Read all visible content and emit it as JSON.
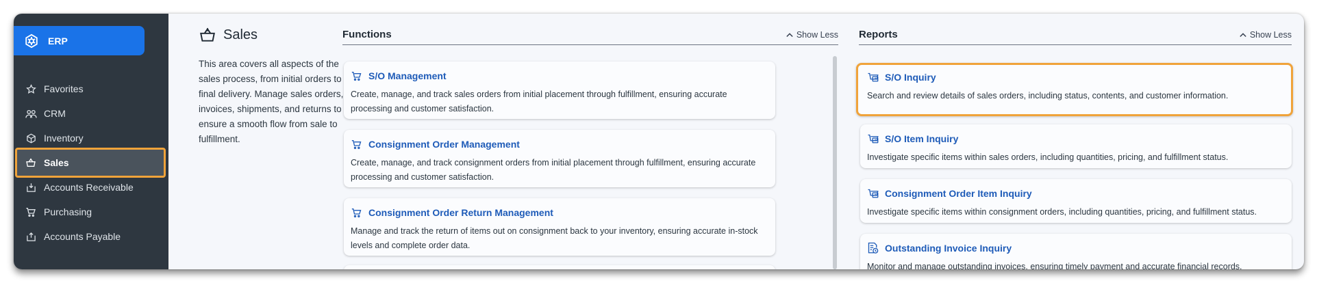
{
  "app": {
    "brand": "ERP"
  },
  "sidebar": {
    "items": [
      {
        "label": "Favorites",
        "icon": "star-icon"
      },
      {
        "label": "CRM",
        "icon": "people-icon"
      },
      {
        "label": "Inventory",
        "icon": "box-icon"
      },
      {
        "label": "Sales",
        "icon": "basket-icon",
        "active": true
      },
      {
        "label": "Accounts Receivable",
        "icon": "money-in-icon"
      },
      {
        "label": "Purchasing",
        "icon": "cart-icon"
      },
      {
        "label": "Accounts Payable",
        "icon": "money-out-icon"
      }
    ]
  },
  "section": {
    "title": "Sales",
    "description": "This area covers all aspects of the sales process, from initial orders to final delivery. Manage sales orders, invoices, shipments, and returns to ensure a smooth flow from sale to fulfillment."
  },
  "functions": {
    "title": "Functions",
    "toggle": "Show Less",
    "cards": [
      {
        "title": "S/O Management",
        "desc": "Create, manage, and track sales orders from initial placement through fulfillment, ensuring accurate processing and customer satisfaction."
      },
      {
        "title": "Consignment Order Management",
        "desc": "Create, manage, and track consignment orders from initial placement through fulfillment, ensuring accurate processing and customer satisfaction."
      },
      {
        "title": "Consignment Order Return Management",
        "desc": "Manage and track the return of items out on consignment back to your inventory, ensuring accurate in-stock levels and complete order data."
      }
    ]
  },
  "reports": {
    "title": "Reports",
    "toggle": "Show Less",
    "cards": [
      {
        "title": "S/O Inquiry",
        "desc": "Search and review details of sales orders, including status, contents, and customer information.",
        "highlighted": true
      },
      {
        "title": "S/O Item Inquiry",
        "desc": "Investigate specific items within sales orders, including quantities, pricing, and fulfillment status."
      },
      {
        "title": "Consignment Order Item Inquiry",
        "desc": "Investigate specific items within consignment orders, including quantities, pricing, and fulfillment status."
      },
      {
        "title": "Outstanding Invoice Inquiry",
        "desc": "Monitor and manage outstanding invoices, ensuring timely payment and accurate financial records."
      }
    ]
  },
  "colors": {
    "accent": "#1a73e8",
    "highlight": "#f0a33a",
    "sidebar": "#2e3740",
    "link": "#1e5bb8"
  }
}
